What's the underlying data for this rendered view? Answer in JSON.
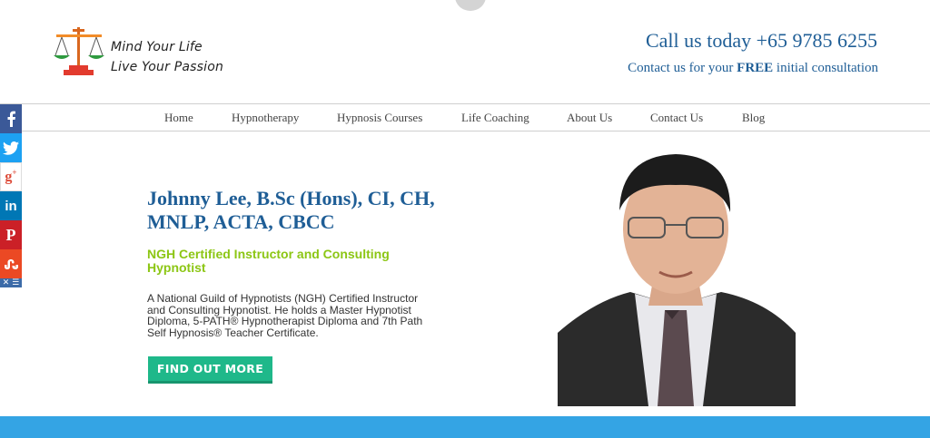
{
  "header": {
    "logo_line1": "Mind Your Life",
    "logo_line2": "Live Your Passion",
    "call_text": "Call us today +65 9785 6255",
    "contact_prefix": "Contact us for your",
    "contact_bold": "FREE",
    "contact_suffix": "initial consultation"
  },
  "nav": {
    "items": [
      {
        "label": "Home"
      },
      {
        "label": "Hypnotherapy"
      },
      {
        "label": "Hypnosis Courses"
      },
      {
        "label": "Life Coaching"
      },
      {
        "label": "About Us"
      },
      {
        "label": "Contact Us"
      },
      {
        "label": "Blog"
      }
    ]
  },
  "share": {
    "icons": [
      "facebook-icon",
      "twitter-icon",
      "google-plus-icon",
      "linkedin-icon",
      "pinterest-icon",
      "stumbleupon-icon",
      "close-menu-icon"
    ]
  },
  "hero": {
    "title": "Johnny Lee, B.Sc (Hons), CI, CH, MNLP, ACTA, CBCC",
    "subtitle": "NGH Certified Instructor and Consulting Hypnotist",
    "description": "A National Guild of Hypnotists (NGH) Certified Instructor and Consulting Hypnotist. He holds a Master Hypnotist Diploma, 5-PATH® Hypnotherapist Diploma and 7th Path Self Hypnosis® Teacher Certificate.",
    "cta_label": "FIND OUT MORE"
  },
  "colors": {
    "brand_blue": "#1f5e96",
    "accent_green": "#8cc614",
    "cta_green": "#1fb88a",
    "band_blue": "#34a4e4"
  }
}
